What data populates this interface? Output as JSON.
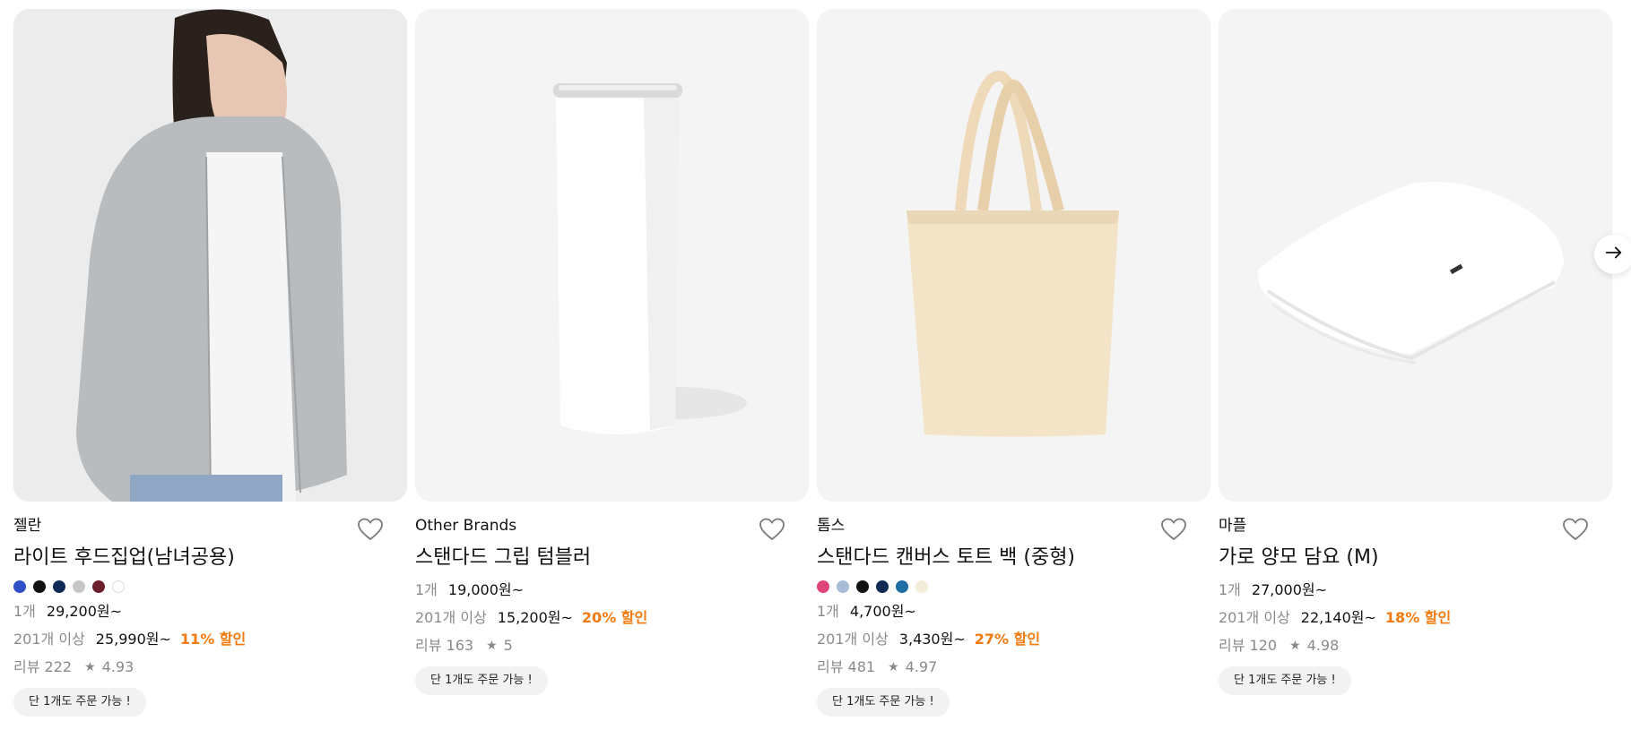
{
  "products": [
    {
      "brand": "젤란",
      "name": "라이트 후드집업(남녀공용)",
      "swatches": [
        "#2f4fc6",
        "#111111",
        "#0f2a55",
        "#c7c7c7",
        "#6b1f2a",
        "#ffffff"
      ],
      "tier1": {
        "qty": "1개",
        "price": "29,200원~"
      },
      "tier2": {
        "qty": "201개 이상",
        "price": "25,990원~",
        "discount": "11% 할인"
      },
      "reviews": "리뷰 222",
      "rating": "4.93",
      "badge": "단 1개도 주문 가능 !"
    },
    {
      "brand": "Other Brands",
      "name": "스탠다드 그립 텀블러",
      "swatches": [],
      "tier1": {
        "qty": "1개",
        "price": "19,000원~"
      },
      "tier2": {
        "qty": "201개 이상",
        "price": "15,200원~",
        "discount": "20% 할인"
      },
      "reviews": "리뷰 163",
      "rating": "5",
      "badge": "단 1개도 주문 가능 !"
    },
    {
      "brand": "톰스",
      "name": "스탠다드 캔버스 토트 백 (중형)",
      "swatches": [
        "#e0447a",
        "#a9bcd6",
        "#111111",
        "#0f2a55",
        "#1c6ea4",
        "#f3ecd9"
      ],
      "tier1": {
        "qty": "1개",
        "price": "4,700원~"
      },
      "tier2": {
        "qty": "201개 이상",
        "price": "3,430원~",
        "discount": "27% 할인"
      },
      "reviews": "리뷰 481",
      "rating": "4.97",
      "badge": "단 1개도 주문 가능 !"
    },
    {
      "brand": "마플",
      "name": "가로 양모 담요 (M)",
      "swatches": [],
      "tier1": {
        "qty": "1개",
        "price": "27,000원~"
      },
      "tier2": {
        "qty": "201개 이상",
        "price": "22,140원~",
        "discount": "18% 할인"
      },
      "reviews": "리뷰 120",
      "rating": "4.98",
      "badge": "단 1개도 주문 가능 !"
    }
  ],
  "icons": {
    "heart": "heart-outline-icon",
    "star": "star-icon",
    "next": "arrow-right-icon"
  },
  "colors": {
    "discount": "#f27a0e",
    "muted": "#8a8a8a",
    "card_bg": "#f4f4f4"
  }
}
